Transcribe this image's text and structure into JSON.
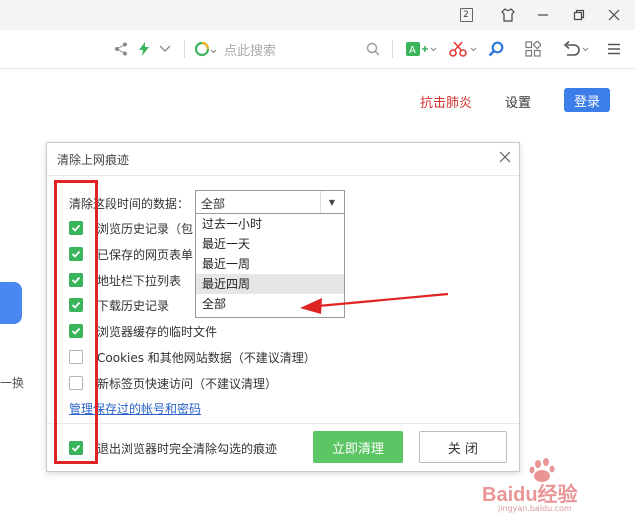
{
  "window": {
    "tab_count": "2"
  },
  "toolbar": {
    "search_placeholder": "点此搜索"
  },
  "header": {
    "link_1": "抗击肺炎",
    "link_2": "设置",
    "login": "登录"
  },
  "edge": {
    "text": "一换"
  },
  "dialog": {
    "title": "清除上网痕迹",
    "range_label": "清除这段时间的数据：",
    "range_selected": "全部",
    "range_options": [
      "过去一小时",
      "最近一天",
      "最近一周",
      "最近四周",
      "全部"
    ],
    "items": [
      {
        "label": "浏览历史记录（包",
        "checked": true
      },
      {
        "label": "已保存的网页表单",
        "checked": true
      },
      {
        "label": "地址栏下拉列表",
        "checked": true
      },
      {
        "label": "下载历史记录",
        "checked": true
      },
      {
        "label": "浏览器缓存的临时文件",
        "checked": true
      },
      {
        "label": "Cookies 和其他网站数据（不建议清理）",
        "checked": false
      },
      {
        "label": "新标签页快速访问（不建议清理）",
        "checked": false
      }
    ],
    "manage_link": "管理保存过的帐号和密码",
    "exit_clear_label": "退出浏览器时完全清除勾选的痕迹",
    "clean_button": "立即清理",
    "close_button": "关 闭"
  },
  "watermark": {
    "text": "Baidu经验",
    "sub": "jingyan.baidu.com"
  },
  "colors": {
    "accent": "#3b7de9",
    "check_green": "#3bb55c",
    "annotation_red": "#e02424",
    "clean_green": "#5cc664"
  }
}
